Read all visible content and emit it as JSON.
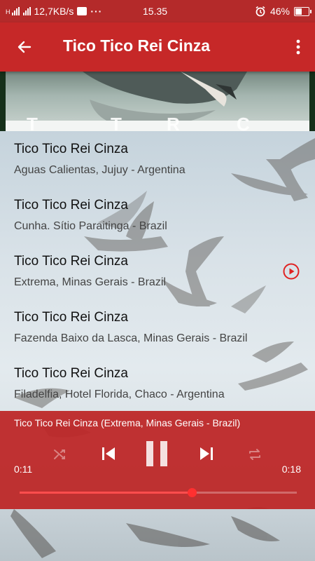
{
  "status_bar": {
    "speed": "12,7KB/s",
    "time": "15.35",
    "battery": "46%",
    "network_label": "H",
    "icons": [
      "signal-icon",
      "bbm-icon",
      "more-dots-icon",
      "alarm-icon",
      "battery-icon"
    ]
  },
  "app_bar": {
    "title": "Tico Tico Rei Cinza",
    "icons": [
      "back-arrow-icon",
      "overflow-menu-icon"
    ]
  },
  "colors": {
    "primary": "#c62828",
    "status_bar": "#b42a2a",
    "player": "#bc2323",
    "accent": "#ff3030"
  },
  "tracks": [
    {
      "title": "Tico Tico Rei Cinza",
      "subtitle": "Aguas Calientas, Jujuy - Argentina",
      "playing": false
    },
    {
      "title": "Tico Tico Rei Cinza",
      "subtitle": "Cunha. Sítio Paraitinga - Brazil",
      "playing": false
    },
    {
      "title": "Tico Tico Rei Cinza",
      "subtitle": "Extrema, Minas Gerais - Brazil",
      "playing": true
    },
    {
      "title": "Tico Tico Rei Cinza",
      "subtitle": "Fazenda Baixo da Lasca, Minas Gerais - Brazil",
      "playing": false
    },
    {
      "title": "Tico Tico Rei Cinza",
      "subtitle": "Filadelfia, Hotel Florida, Chaco - Argentina",
      "playing": false
    }
  ],
  "player": {
    "now_playing": "Tico Tico Rei Cinza (Extrema, Minas Gerais - Brazil)",
    "elapsed": "0:11",
    "duration": "0:18",
    "progress": 0.62,
    "icons": [
      "shuffle-icon",
      "previous-icon",
      "pause-icon",
      "next-icon",
      "repeat-icon"
    ]
  }
}
